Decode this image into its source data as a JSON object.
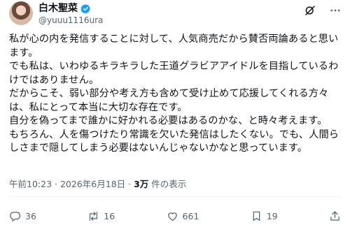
{
  "author": {
    "name": "白木聖菜",
    "handle": "@yuuu1116ura"
  },
  "post": {
    "lines": [
      "私が心の内を発信することに対して、人気商売だから賛否両論あると思い",
      "ます。",
      "でも私は、いわゆるキラキラした王道グラビアアイドルを目指しているわ",
      "けではありません。",
      "だからこそ、弱い部分や考え方も含めて受け止めて応援してくれる方々",
      "は、私にとって本当に大切な存在です。",
      "自分を偽ってまで誰かに好かれる必要はあるのかな、と時々考えます。",
      "もちろん、人を傷つけたり常識を欠いた発信はしたくない。でも、人間ら",
      "しさまで隠してしまう必要はないんじゃないかなと思っています。"
    ]
  },
  "meta": {
    "time": "午前10:23",
    "separator": "·",
    "date": "2026年6月18日",
    "views_count": "3万",
    "views_label": "件の表示"
  },
  "actions": {
    "replies": "36",
    "reposts": "16",
    "likes": "661",
    "bookmarks": "19"
  },
  "icons": {
    "verified": "verified-badge-icon",
    "grok": "grok-icon",
    "more": "more-icon",
    "reply": "reply-icon",
    "repost": "repost-icon",
    "like": "like-icon",
    "bookmark": "bookmark-icon",
    "share": "share-icon"
  },
  "colors": {
    "verified": "#1d9bf0",
    "text": "#0f1419",
    "muted": "#536471"
  }
}
